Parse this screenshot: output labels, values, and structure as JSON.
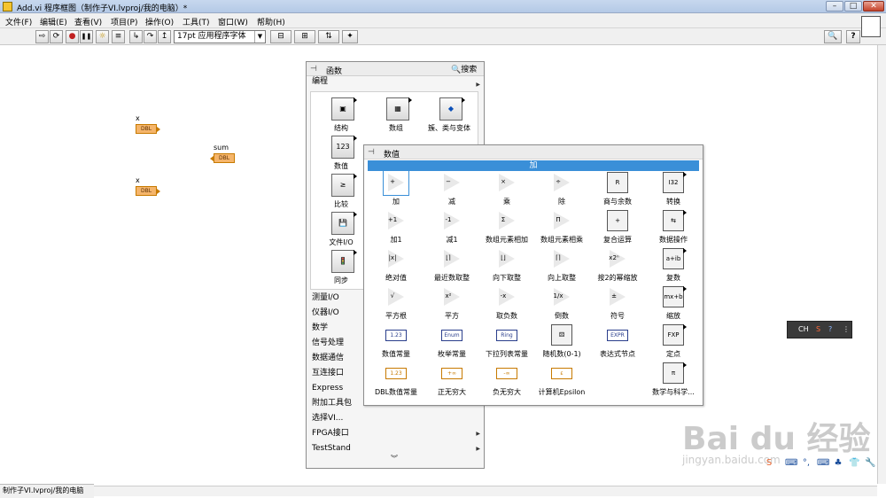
{
  "window": {
    "title": "Add.vi 程序框图（制作子VI.lvproj/我的电脑）*",
    "buttons": {
      "minimize": "–",
      "maximize": "□",
      "close": "✕"
    }
  },
  "menu": [
    "文件(F)",
    "编辑(E)",
    "查看(V)",
    "项目(P)",
    "操作(O)",
    "工具(T)",
    "窗口(W)",
    "帮助(H)"
  ],
  "toolbar": {
    "font": "17pt 应用程序字体",
    "buttons": [
      {
        "name": "run-arrow-icon",
        "glyph": "⇨"
      },
      {
        "name": "run-continuous-icon",
        "glyph": "⟳"
      },
      {
        "name": "abort-icon",
        "glyph": "●"
      },
      {
        "name": "pause-icon",
        "glyph": "❚❚"
      },
      {
        "name": "highlight-execution-icon",
        "glyph": "☼"
      },
      {
        "name": "retain-wire-values-icon",
        "glyph": "≡"
      },
      {
        "name": "step-into-icon",
        "glyph": "↳"
      },
      {
        "name": "step-over-icon",
        "glyph": "↷"
      },
      {
        "name": "step-out-icon",
        "glyph": "↥"
      }
    ],
    "help_search": "🔍",
    "help": "?"
  },
  "diagram": {
    "terminals": [
      {
        "label": "x",
        "type": "DBL"
      },
      {
        "label": "sum",
        "type": "DBL"
      },
      {
        "label": "x",
        "type": "DBL"
      }
    ]
  },
  "statusbar": "制作子VI.lvproj/我的电脑",
  "functions_palette": {
    "title": "函数",
    "search": "搜索",
    "category": "编程",
    "items": [
      {
        "label": "结构",
        "icon": "structures-icon"
      },
      {
        "label": "数组",
        "icon": "array-icon"
      },
      {
        "label": "簇、类与变体",
        "icon": "cluster-icon"
      },
      {
        "label": "数值",
        "icon": "numeric-icon"
      },
      {
        "label": "比较",
        "icon": "comparison-icon"
      },
      {
        "label": "文件I/O",
        "icon": "file-io-icon"
      },
      {
        "label": "同步",
        "icon": "synchronization-icon"
      }
    ],
    "categories": [
      "测量I/O",
      "仪器I/O",
      "数学",
      "信号处理",
      "数据通信",
      "互连接口",
      "Express",
      "附加工具包",
      "选择VI...",
      "FPGA接口",
      "TestStand"
    ]
  },
  "numeric_palette": {
    "title": "数值",
    "tooltip": "加",
    "items": [
      {
        "label": "加",
        "glyph": "+",
        "kind": "tri"
      },
      {
        "label": "减",
        "glyph": "−",
        "kind": "tri"
      },
      {
        "label": "乘",
        "glyph": "×",
        "kind": "tri"
      },
      {
        "label": "除",
        "glyph": "÷",
        "kind": "tri"
      },
      {
        "label": "商与余数",
        "glyph": "R",
        "kind": "box"
      },
      {
        "label": "转换",
        "glyph": "I32",
        "kind": "box-sub"
      },
      {
        "label": "加1",
        "glyph": "+1",
        "kind": "tri"
      },
      {
        "label": "减1",
        "glyph": "-1",
        "kind": "tri"
      },
      {
        "label": "数组元素相加",
        "glyph": "Σ",
        "kind": "tri"
      },
      {
        "label": "数组元素相乘",
        "glyph": "Π",
        "kind": "tri"
      },
      {
        "label": "复合运算",
        "glyph": "+",
        "kind": "box"
      },
      {
        "label": "数据操作",
        "glyph": "⇆",
        "kind": "box-sub"
      },
      {
        "label": "绝对值",
        "glyph": "|x|",
        "kind": "tri"
      },
      {
        "label": "最近数取整",
        "glyph": "⌊⌉",
        "kind": "tri"
      },
      {
        "label": "向下取整",
        "glyph": "⌊⌋",
        "kind": "tri"
      },
      {
        "label": "向上取整",
        "glyph": "⌈⌉",
        "kind": "tri"
      },
      {
        "label": "按2的幂缩放",
        "glyph": "x2ⁿ",
        "kind": "tri"
      },
      {
        "label": "复数",
        "glyph": "a+ib",
        "kind": "box-sub"
      },
      {
        "label": "平方根",
        "glyph": "√",
        "kind": "tri"
      },
      {
        "label": "平方",
        "glyph": "x²",
        "kind": "tri"
      },
      {
        "label": "取负数",
        "glyph": "-x",
        "kind": "tri"
      },
      {
        "label": "倒数",
        "glyph": "1/x",
        "kind": "tri"
      },
      {
        "label": "符号",
        "glyph": "±",
        "kind": "tri"
      },
      {
        "label": "缩放",
        "glyph": "mx+b",
        "kind": "box-sub"
      },
      {
        "label": "数值常量",
        "glyph": "1.23",
        "kind": "const"
      },
      {
        "label": "枚举常量",
        "glyph": "Enum",
        "kind": "const"
      },
      {
        "label": "下拉列表常量",
        "glyph": "Ring",
        "kind": "const"
      },
      {
        "label": "随机数(0-1)",
        "glyph": "⚄",
        "kind": "box"
      },
      {
        "label": "表达式节点",
        "glyph": "EXPR",
        "kind": "const"
      },
      {
        "label": "定点",
        "glyph": "FXP",
        "kind": "box-sub"
      },
      {
        "label": "DBL数值常量",
        "glyph": "1.23",
        "kind": "const-dbl"
      },
      {
        "label": "正无穷大",
        "glyph": "+∞",
        "kind": "const-dbl"
      },
      {
        "label": "负无穷大",
        "glyph": "-∞",
        "kind": "const-dbl"
      },
      {
        "label": "计算机Epsilon",
        "glyph": "ε",
        "kind": "const-dbl"
      },
      {
        "label": "",
        "glyph": "",
        "kind": "empty"
      },
      {
        "label": "数学与科学...",
        "glyph": "π",
        "kind": "box-sub"
      }
    ]
  },
  "ime": {
    "text": "CH"
  },
  "watermark": {
    "logo": "Bai du 经验",
    "url": "jingyan.baidu.com"
  }
}
